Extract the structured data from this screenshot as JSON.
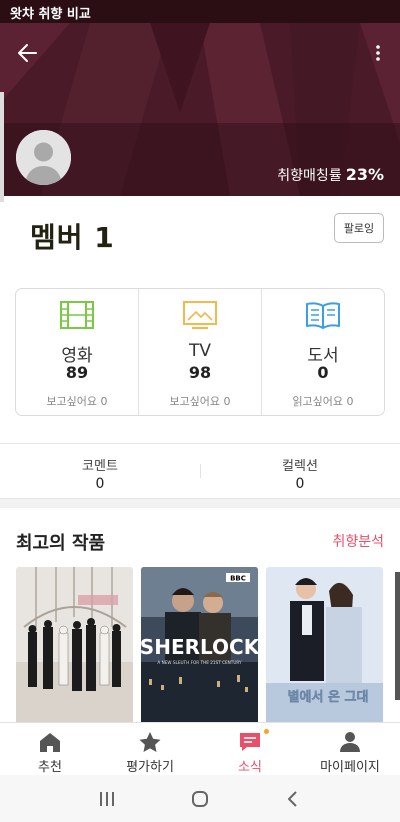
{
  "status_bar": {
    "title": "왓챠 취향 비교"
  },
  "header": {
    "match_label": "취향매칭률",
    "match_value": "23%"
  },
  "profile": {
    "name": "멤버 1",
    "follow_label": "팔로잉"
  },
  "stats": [
    {
      "label": "영화",
      "count": "89",
      "sub": "보고싶어요 0",
      "icon": "film-icon",
      "color": "#7ac943"
    },
    {
      "label": "TV",
      "count": "98",
      "sub": "보고싶어요 0",
      "icon": "tv-icon",
      "color": "#f5b84a"
    },
    {
      "label": "도서",
      "count": "0",
      "sub": "읽고싶어요 0",
      "icon": "book-icon",
      "color": "#3aa0e0"
    }
  ],
  "counts": [
    {
      "label": "코멘트",
      "value": "0"
    },
    {
      "label": "컬렉션",
      "value": "0"
    }
  ],
  "best": {
    "title": "최고의 작품",
    "link": "취향분석",
    "posters": [
      {
        "name": "poster-boys-over-flowers"
      },
      {
        "name": "poster-sherlock",
        "text": "SHERLOCK",
        "badge": "BBC",
        "tagline": "A NEW SLEUTH FOR THE 21ST CENTURY"
      },
      {
        "name": "poster-my-love-from-the-star",
        "text": "별에서 온 그대"
      }
    ]
  },
  "nav": [
    {
      "label": "추천",
      "icon": "home-icon"
    },
    {
      "label": "평가하기",
      "icon": "star-icon"
    },
    {
      "label": "소식",
      "icon": "chat-icon",
      "active": true
    },
    {
      "label": "마이페이지",
      "icon": "person-icon"
    }
  ],
  "colors": {
    "accent": "#e84f6a",
    "banner": "#4b1a28",
    "notify_dot": "#f5a623"
  }
}
